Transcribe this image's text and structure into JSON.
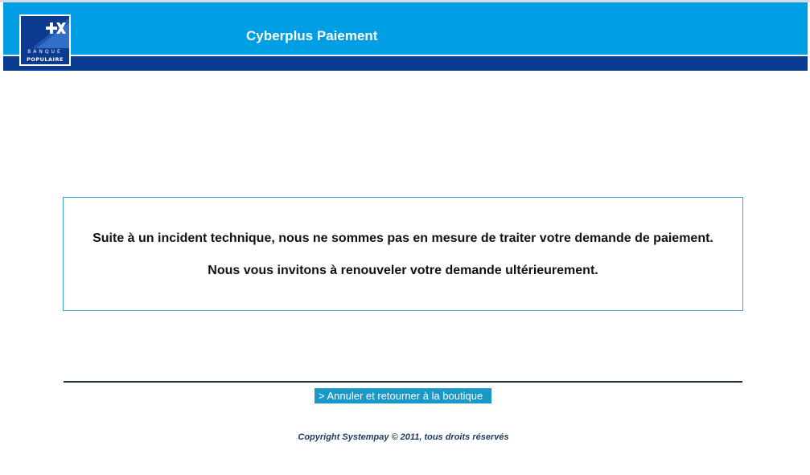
{
  "header": {
    "title": "Cyberplus Paiement",
    "logo": {
      "line1": "BANQUE",
      "line2": "POPULAIRE",
      "mark": "+X"
    },
    "colors": {
      "header_bg": "#009ee4",
      "header_band": "#0a3d91",
      "logo_bg": "#0c3a8e"
    }
  },
  "message": {
    "line1": "Suite à un incident technique, nous ne sommes pas en mesure de traiter votre demande de paiement.",
    "line2": "Nous vous invitons à renouveler votre demande ultérieurement."
  },
  "actions": {
    "cancel_label": "> Annuler et retourner à la boutique"
  },
  "footer": {
    "copyright": "Copyright Systempay © 2011, tous droits réservés"
  }
}
